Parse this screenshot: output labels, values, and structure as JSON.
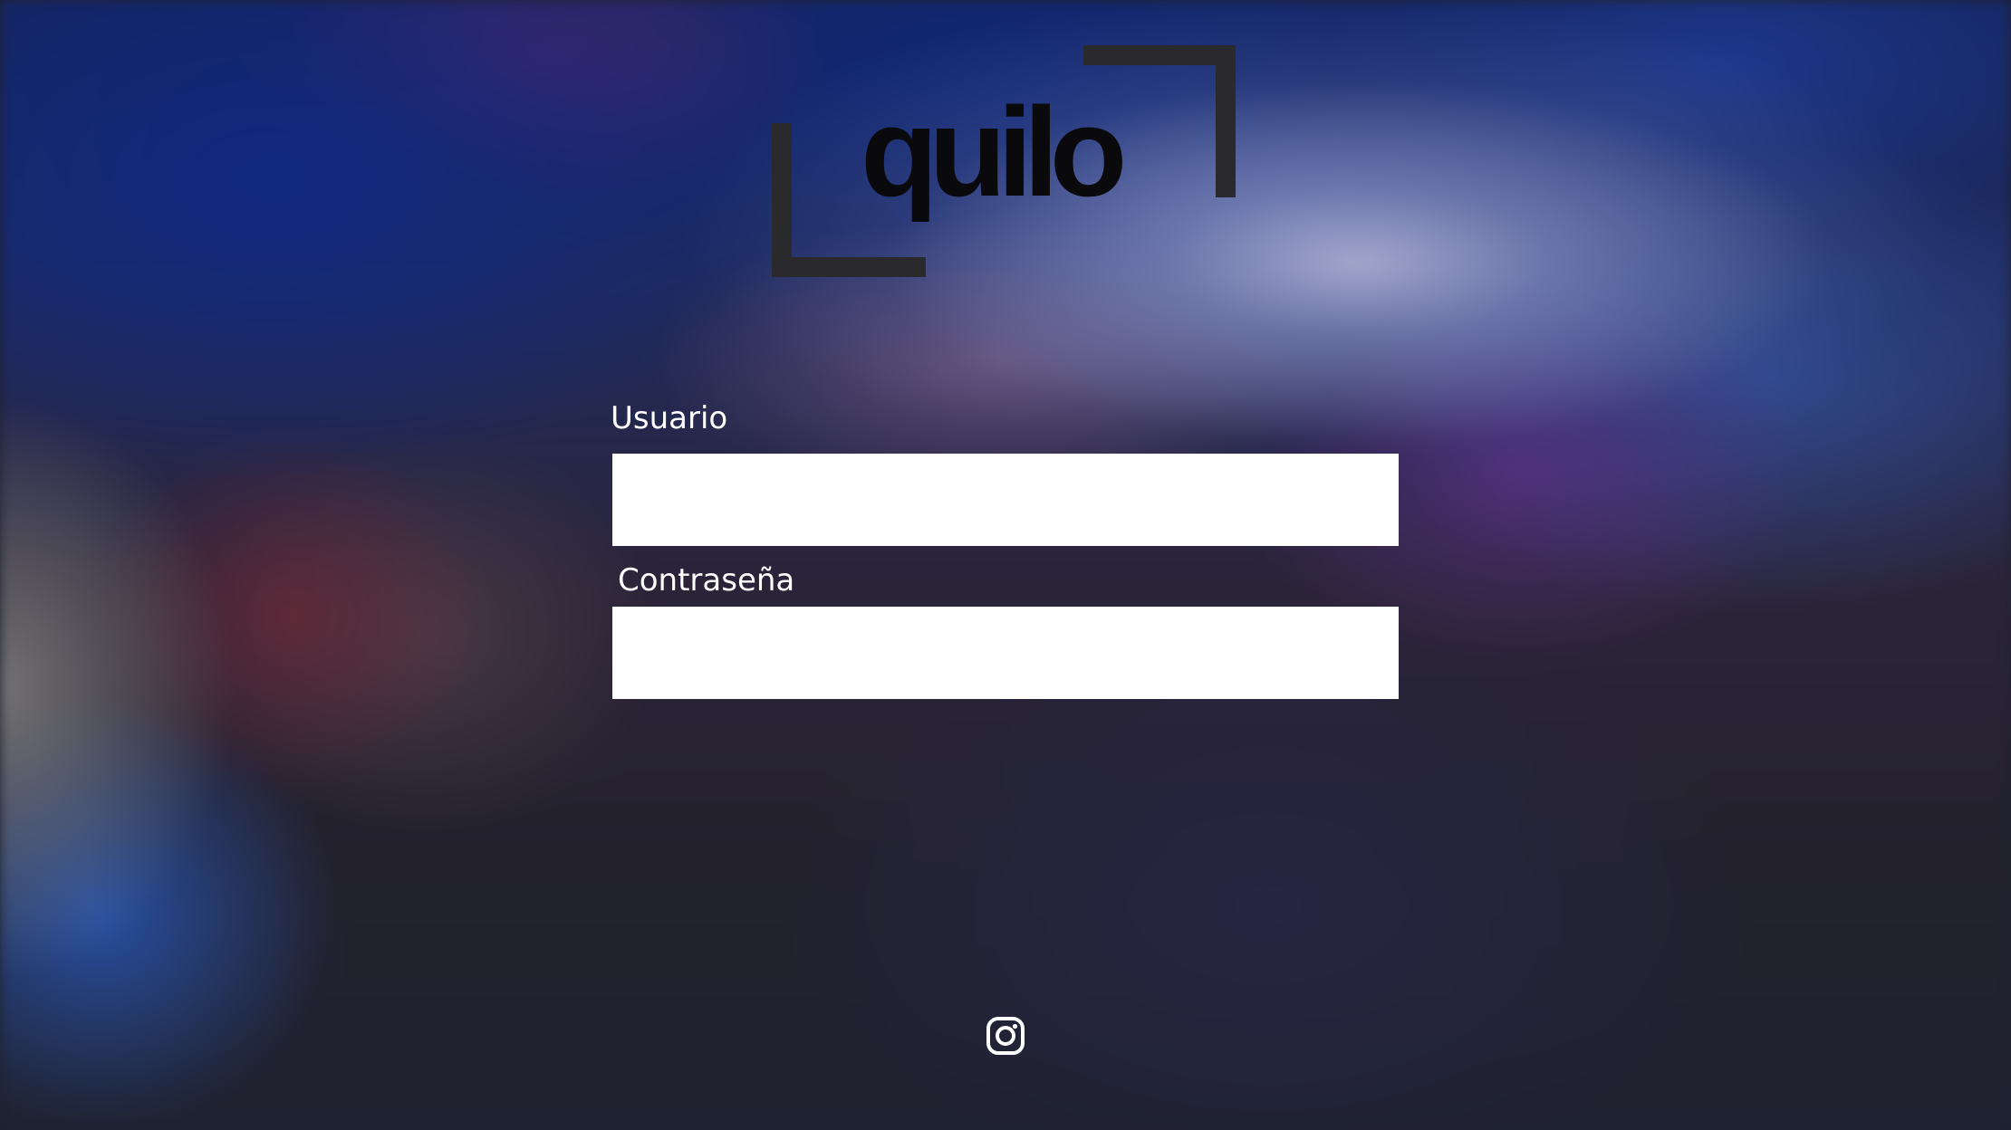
{
  "brand": {
    "logo_text": "quilo"
  },
  "login": {
    "username_label": "Usuario",
    "username_value": "",
    "password_label": "Contraseña",
    "password_value": ""
  },
  "footer": {
    "social_icon": "instagram-icon"
  },
  "colors": {
    "logo_bracket": "#2a2a2d",
    "logo_text": "#0a0a0c",
    "label_text": "#ffffff",
    "field_background": "#ffffff"
  }
}
